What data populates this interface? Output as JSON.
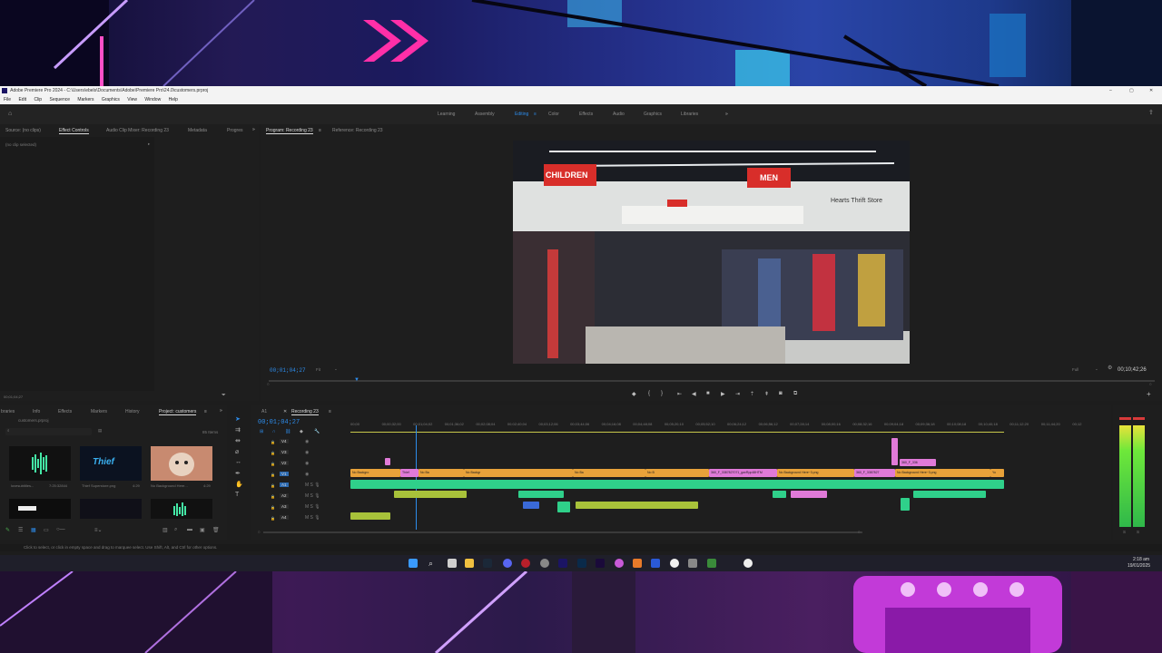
{
  "window": {
    "title": "Adobe Premiere Pro 2024 - C:\\Users\\ebels\\Documents\\Adobe\\Premiere Pro\\24.0\\customers.prproj",
    "controls": [
      "–",
      "▢",
      "✕"
    ]
  },
  "menu": [
    "File",
    "Edit",
    "Clip",
    "Sequence",
    "Markers",
    "Graphics",
    "View",
    "Window",
    "Help"
  ],
  "workspaces": {
    "items": [
      "Learning",
      "Assembly",
      "Editing",
      "Color",
      "Effects",
      "Audio",
      "Graphics",
      "Libraries"
    ],
    "active": "Editing",
    "more": "»"
  },
  "source_panel": {
    "tabs": [
      "Source: (no clips)",
      "Effect Controls",
      "Audio Clip Mixer: Recording 23",
      "Metadata",
      "Progres"
    ],
    "active_tab": "Effect Controls",
    "no_clip": "(no clip selected)",
    "timecode": "00;01;04;27"
  },
  "program": {
    "tabs": [
      "Program: Recording 23",
      "Reference: Recording 23"
    ],
    "timecode": "00;01;04;27",
    "fit": "Fit",
    "quality": "Full",
    "duration": "00;10;42;26",
    "scene_signs": [
      "CHILDREN",
      "MEN",
      "Hearts Thrift Store"
    ]
  },
  "project": {
    "tabs": [
      "braries",
      "Info",
      "Effects",
      "Markers",
      "History",
      "Project: customers"
    ],
    "active_tab": "Project: customers",
    "file": "customers.prproj",
    "items_count": "85 Items",
    "thumbs": [
      {
        "name": "lovesubtitles...",
        "duration": "7:25:32844"
      },
      {
        "name": "Thief Superstore.png",
        "duration": "4:29"
      },
      {
        "name": "No Background Here...",
        "duration": "4:29"
      }
    ],
    "thumb_text": "Thief"
  },
  "timeline": {
    "sequence_tab": "Recording 23",
    "tab_a1": "A1",
    "timecode": "00;01;04;27",
    "ruler": [
      "00;00",
      "00;00;32;00",
      "00;01;04;02",
      "00;01;36;02",
      "00;02;08;04",
      "00;02;40;04",
      "00;03;12;06",
      "00;03;44;06",
      "00;04;16;08",
      "00;04;48;08",
      "00;05;20;10",
      "00;05;52;10",
      "00;06;24;12",
      "00;06;56;12",
      "00;07;28;14",
      "00;08;00;16",
      "00;08;32;16",
      "00;09;04;18",
      "00;09;36;18",
      "00;10;08;18",
      "00;10;40;18",
      "00;11;12;20",
      "00;11;44;20",
      "00;12"
    ],
    "tracks": [
      "V4",
      "V3",
      "V2",
      "V1",
      "A1",
      "A2",
      "A3",
      "A4"
    ],
    "clip_labels": [
      "No Backgro",
      "Thief",
      "No Ba",
      "No Backgr",
      "No Ba",
      "No B",
      "360_F_3387827071_gavRpp48HTM",
      "No Background Here~3.png",
      "360_F_3387827",
      "No Background Here~3.png",
      "360_F_336",
      "Yo"
    ]
  },
  "status": "Click to select, or click in empty space and drag to marquee select. Use Shift, Alt, and Ctrl for other options.",
  "clock": {
    "time": "2:18 am",
    "date": "19/01/2025"
  },
  "colors": {
    "accent": "#2d8ceb",
    "video_clip": "#e8a23a",
    "pink_clip": "#e07ad8",
    "audio_clip": "#2fd08a"
  }
}
